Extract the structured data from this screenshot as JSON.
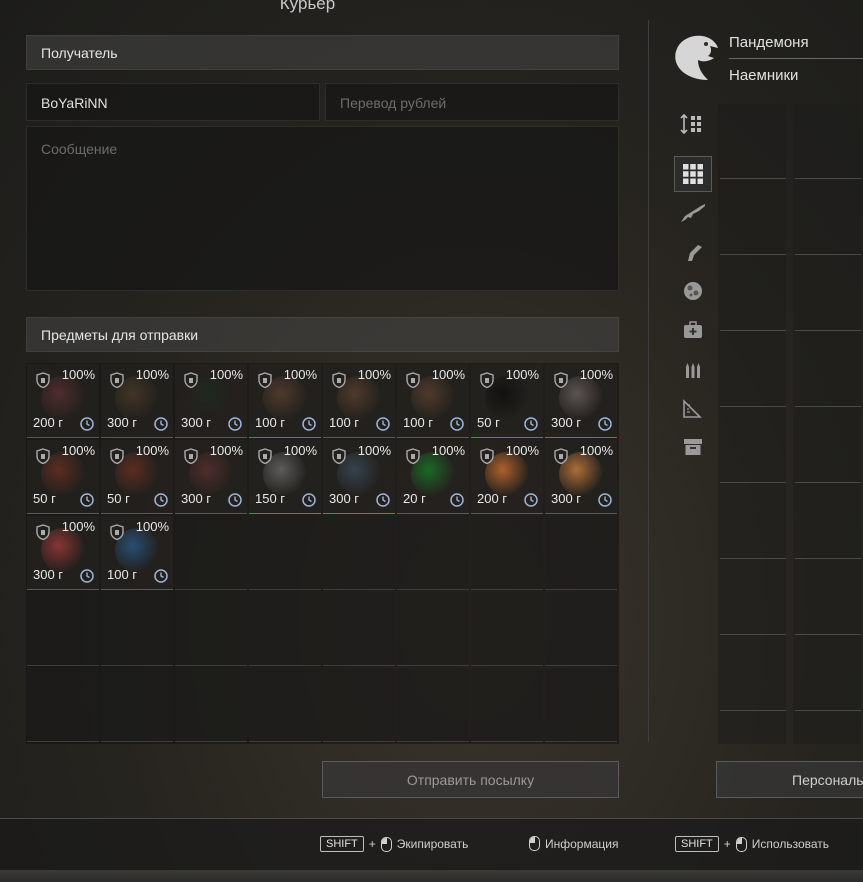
{
  "window": {
    "title": "Курьер"
  },
  "recipient": {
    "header": "Получатель",
    "name_value": "BoYaRiNN",
    "transfer_placeholder": "Перевод рублей",
    "message_placeholder": "Сообщение"
  },
  "items_section": {
    "header": "Предметы для отправки"
  },
  "items": [
    {
      "pct": "100%",
      "price": "200 г",
      "color": "#5a3030",
      "green": false
    },
    {
      "pct": "100%",
      "price": "300 г",
      "color": "#4a3a28",
      "green": false
    },
    {
      "pct": "100%",
      "price": "300 г",
      "color": "#1f2a1f",
      "green": false
    },
    {
      "pct": "100%",
      "price": "100 г",
      "color": "#5a4030",
      "green": true
    },
    {
      "pct": "100%",
      "price": "100 г",
      "color": "#5a4030",
      "green": false
    },
    {
      "pct": "100%",
      "price": "100 г",
      "color": "#5a4030",
      "green": false
    },
    {
      "pct": "100%",
      "price": "50 г",
      "color": "#0e0e0e",
      "green": true
    },
    {
      "pct": "100%",
      "price": "300 г",
      "color": "#6a6060",
      "green": true
    },
    {
      "pct": "100%",
      "price": "50 г",
      "color": "#6a3022",
      "green": false
    },
    {
      "pct": "100%",
      "price": "50 г",
      "color": "#6a3022",
      "green": false
    },
    {
      "pct": "100%",
      "price": "300 г",
      "color": "#5a3030",
      "green": false
    },
    {
      "pct": "100%",
      "price": "150 г",
      "color": "#6a6a6a",
      "green": true
    },
    {
      "pct": "100%",
      "price": "300 г",
      "color": "#3a4a5a",
      "green": true
    },
    {
      "pct": "100%",
      "price": "20 г",
      "color": "#1a7a2a",
      "green": false
    },
    {
      "pct": "100%",
      "price": "200 г",
      "color": "#d07030",
      "green": false
    },
    {
      "pct": "100%",
      "price": "300 г",
      "color": "#d08040",
      "green": false
    },
    {
      "pct": "100%",
      "price": "300 г",
      "color": "#a03a3a",
      "green": false
    },
    {
      "pct": "100%",
      "price": "100 г",
      "color": "#2a5a8a",
      "green": false
    }
  ],
  "send_button": "Отправить посылку",
  "profile": {
    "group": "Пандемоня",
    "faction": "Наемники"
  },
  "sidebar_icons": [
    "sort-icon",
    "grid-icon",
    "rifle-icon",
    "pistol-icon",
    "artifact-icon",
    "medkit-icon",
    "ammo-icon",
    "ruler-icon",
    "box-icon"
  ],
  "personal_button": "Персональ",
  "footer": {
    "shift1": "SHIFT",
    "plus1": "+",
    "equip": "Экипировать",
    "info": "Информация",
    "shift2": "SHIFT",
    "plus2": "+",
    "use": "Использовать"
  }
}
